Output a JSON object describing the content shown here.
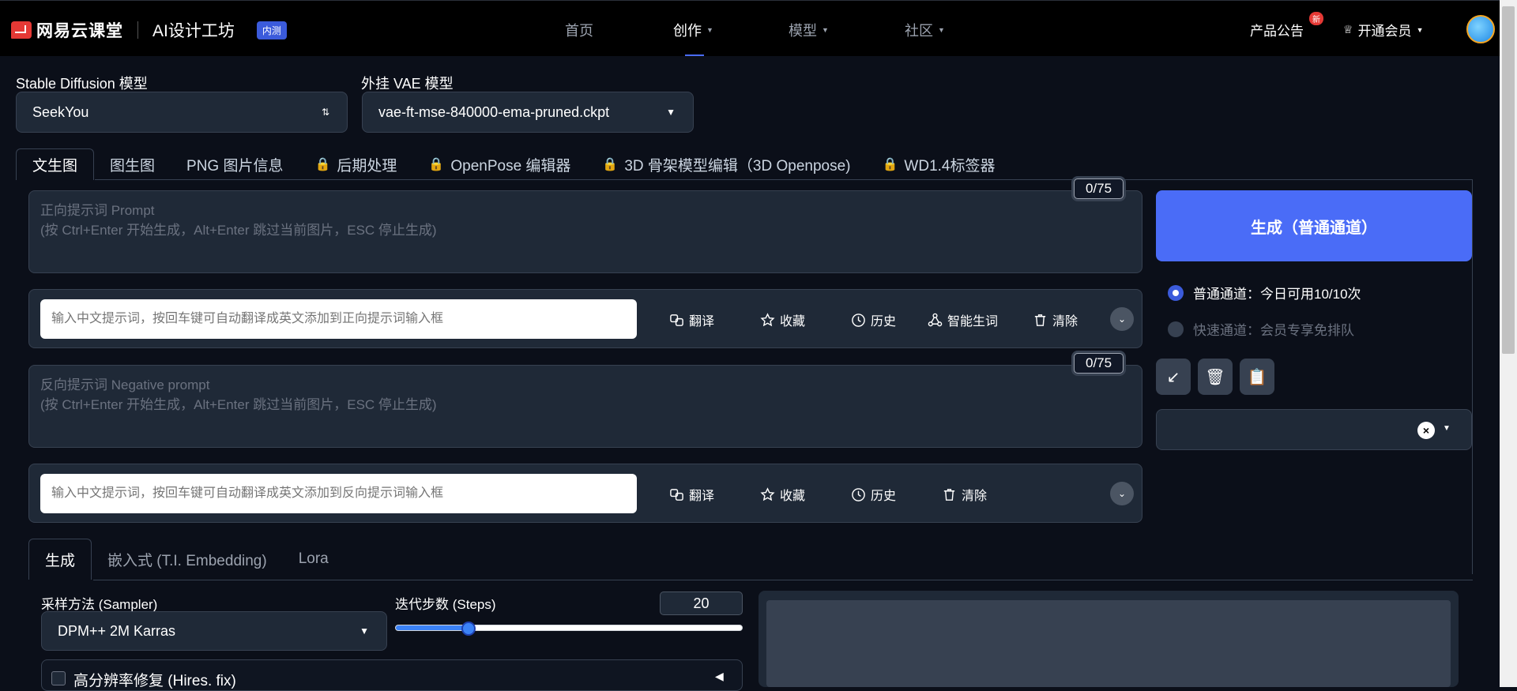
{
  "brand": {
    "name": "网易云课堂",
    "product": "AI设计工坊",
    "badge": "内测"
  },
  "nav": [
    {
      "label": "首页"
    },
    {
      "label": "创作"
    },
    {
      "label": "模型"
    },
    {
      "label": "社区"
    }
  ],
  "header_right": {
    "announcement": "产品公告",
    "new_badge": "新",
    "vip": "开通会员"
  },
  "model": {
    "label": "Stable Diffusion 模型",
    "value": "SeekYou"
  },
  "vae": {
    "label": "外挂 VAE 模型",
    "value": "vae-ft-mse-840000-ema-pruned.ckpt"
  },
  "tabs": [
    "文生图",
    "图生图",
    "PNG 图片信息",
    "后期处理",
    "OpenPose 编辑器",
    "3D 骨架模型编辑（3D Openpose)",
    "WD1.4标签器"
  ],
  "prompt": {
    "placeholder_line1": "正向提示词 Prompt",
    "placeholder_line2": "(按 Ctrl+Enter 开始生成，Alt+Enter 跳过当前图片，ESC 停止生成)",
    "counter": "0/75"
  },
  "prompt_tools": {
    "input_placeholder": "输入中文提示词，按回车键可自动翻译成英文添加到正向提示词输入框",
    "translate": "翻译",
    "favorite": "收藏",
    "history": "历史",
    "smart": "智能生词",
    "clear": "清除"
  },
  "negative": {
    "placeholder_line1": "反向提示词 Negative prompt",
    "placeholder_line2": "(按 Ctrl+Enter 开始生成，Alt+Enter 跳过当前图片，ESC 停止生成)",
    "counter": "0/75"
  },
  "negative_tools": {
    "input_placeholder": "输入中文提示词，按回车键可自动翻译成英文添加到反向提示词输入框",
    "translate": "翻译",
    "favorite": "收藏",
    "history": "历史",
    "clear": "清除"
  },
  "generate": {
    "label": "生成（普通通道）"
  },
  "channels": {
    "normal": "普通通道：今日可用10/10次",
    "fast": "快速通道：会员专享免排队"
  },
  "icon_buttons": {
    "a": "↙",
    "b": "🗑",
    "c": "📋"
  },
  "sub_tabs": [
    "生成",
    "嵌入式 (T.I. Embedding)",
    "Lora"
  ],
  "sampler": {
    "label": "采样方法 (Sampler)",
    "value": "DPM++ 2M Karras"
  },
  "steps": {
    "label": "迭代步数 (Steps)",
    "value": "20",
    "fraction": 0.21
  },
  "hires": {
    "label": "高分辨率修复 (Hires. fix)"
  }
}
